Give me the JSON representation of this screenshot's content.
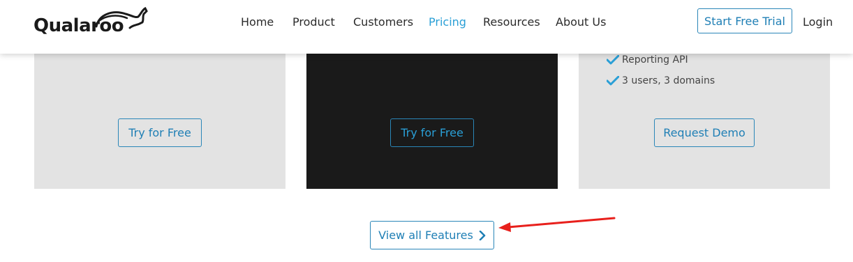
{
  "brand": {
    "name": "Qualaroo"
  },
  "nav": {
    "items": [
      {
        "label": "Home",
        "active": false
      },
      {
        "label": "Product",
        "active": false
      },
      {
        "label": "Customers",
        "active": false
      },
      {
        "label": "Pricing",
        "active": true
      },
      {
        "label": "Resources",
        "active": false
      },
      {
        "label": "About Us",
        "active": false
      }
    ],
    "cta_label": "Start Free Trial",
    "login_label": "Login"
  },
  "plans": [
    {
      "theme": "light",
      "button_label": "Try for Free",
      "features": []
    },
    {
      "theme": "dark",
      "button_label": "Try for Free",
      "features": []
    },
    {
      "theme": "light",
      "button_label": "Request Demo",
      "features": [
        "Reporting API",
        "3 users, 3 domains"
      ]
    }
  ],
  "view_all": {
    "label": "View all Features",
    "icon": "chevron-right-icon"
  },
  "annotation": {
    "icon": "red-arrow-icon",
    "color": "#e8201c"
  },
  "colors": {
    "accent": "#2a9fd6",
    "button_border": "#2a86b8",
    "card_light": "#e3e3e3",
    "card_dark": "#1a1a1a",
    "check": "#2a9fd6"
  }
}
